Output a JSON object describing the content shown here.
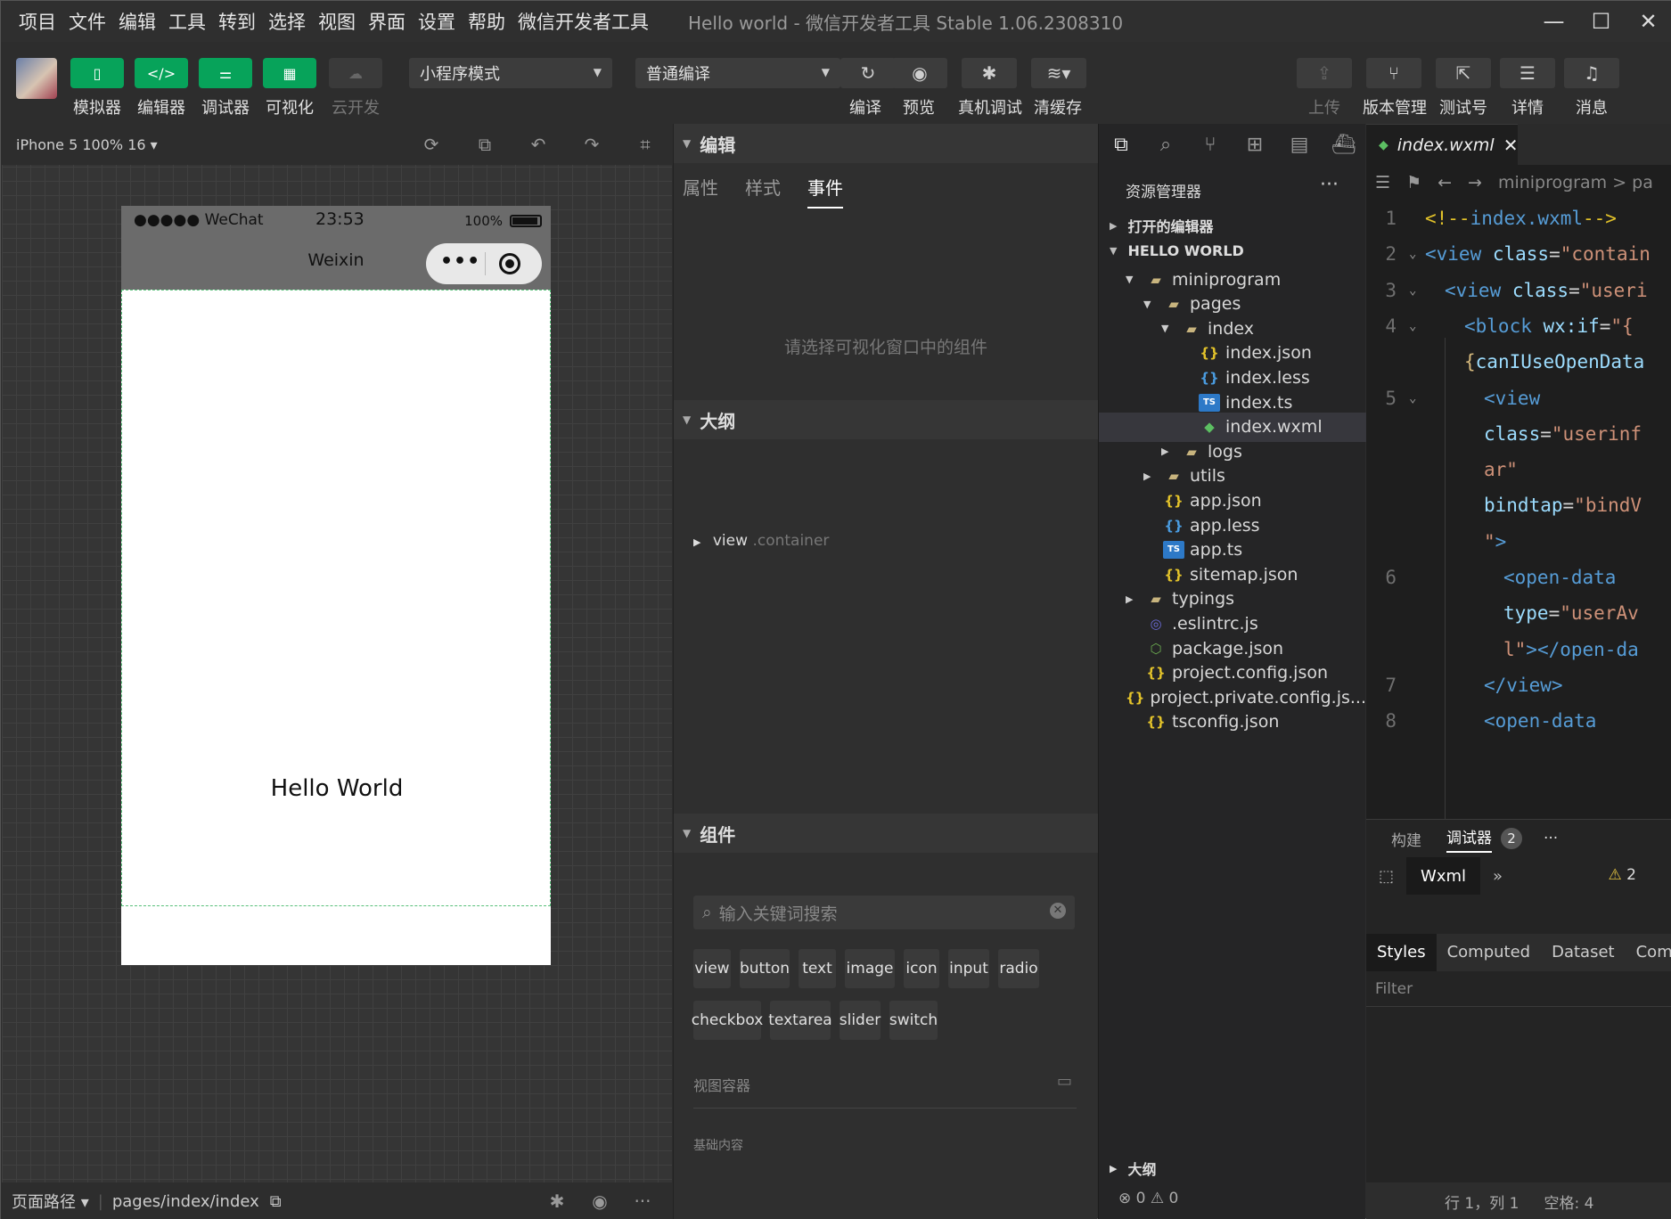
{
  "menu": [
    "项目",
    "文件",
    "编辑",
    "工具",
    "转到",
    "选择",
    "视图",
    "界面",
    "设置",
    "帮助",
    "微信开发者工具"
  ],
  "window_title": "Hello world - 微信开发者工具 Stable 1.06.2308310",
  "toolbar": {
    "simulator": "模拟器",
    "editor": "编辑器",
    "debugger": "调试器",
    "visual": "可视化",
    "cloud": "云开发",
    "mode_select": "小程序模式",
    "compile_select": "普通编译",
    "compile": "编译",
    "preview": "预览",
    "real_debug": "真机调试",
    "clear_cache": "清缓存",
    "upload": "上传",
    "version_mgmt": "版本管理",
    "test_account": "测试号",
    "details": "详情",
    "messages": "消息"
  },
  "simulator": {
    "device": "iPhone 5 100% 16",
    "status_left": "●●●●● WeChat",
    "time": "23:53",
    "battery": "100%",
    "nav_title": "Weixin",
    "content": "Hello World",
    "footer_label": "页面路径",
    "footer_path": "pages/index/index"
  },
  "edit_panel": {
    "title": "编辑",
    "tabs": [
      "属性",
      "样式",
      "事件"
    ],
    "active_tab": "事件",
    "hint": "请选择可视化窗口中的组件",
    "outline_title": "大纲",
    "outline_item": "view",
    "outline_class": ".container",
    "components_title": "组件",
    "search_placeholder": "输入关键词搜索",
    "chips_row1": [
      "view",
      "button",
      "text",
      "image",
      "icon",
      "input",
      "radio"
    ],
    "chips_row2": [
      "checkbox",
      "textarea",
      "slider",
      "switch"
    ],
    "group1": "视图容器",
    "group2": "基础内容"
  },
  "explorer": {
    "title": "资源管理器",
    "open_editors": "打开的编辑器",
    "project": "HELLO WORLD",
    "tree": [
      {
        "name": "miniprogram",
        "depth": 1,
        "type": "folder",
        "open": true
      },
      {
        "name": "pages",
        "depth": 2,
        "type": "folder",
        "open": true
      },
      {
        "name": "index",
        "depth": 3,
        "type": "folder",
        "open": true
      },
      {
        "name": "index.json",
        "depth": 4,
        "type": "json"
      },
      {
        "name": "index.less",
        "depth": 4,
        "type": "less"
      },
      {
        "name": "index.ts",
        "depth": 4,
        "type": "ts"
      },
      {
        "name": "index.wxml",
        "depth": 4,
        "type": "wxml",
        "selected": true
      },
      {
        "name": "logs",
        "depth": 3,
        "type": "folder",
        "open": false
      },
      {
        "name": "utils",
        "depth": 2,
        "type": "folder",
        "open": false
      },
      {
        "name": "app.json",
        "depth": 2,
        "type": "json"
      },
      {
        "name": "app.less",
        "depth": 2,
        "type": "less"
      },
      {
        "name": "app.ts",
        "depth": 2,
        "type": "ts"
      },
      {
        "name": "sitemap.json",
        "depth": 2,
        "type": "json"
      },
      {
        "name": "typings",
        "depth": 1,
        "type": "folder",
        "open": false
      },
      {
        "name": ".eslintrc.js",
        "depth": 1,
        "type": "eslint"
      },
      {
        "name": "package.json",
        "depth": 1,
        "type": "node"
      },
      {
        "name": "project.config.json",
        "depth": 1,
        "type": "json"
      },
      {
        "name": "project.private.config.js...",
        "depth": 1,
        "type": "json"
      },
      {
        "name": "tsconfig.json",
        "depth": 1,
        "type": "json"
      }
    ],
    "outline": "大纲",
    "status": "⊗ 0 ⚠ 0"
  },
  "editor": {
    "tab": "index.wxml",
    "breadcrumb": "miniprogram > pa",
    "lines": [
      {
        "n": "1",
        "fold": false,
        "indent": 0,
        "parts": [
          [
            "com",
            "<!--"
          ],
          [
            "tag",
            "index.wxml"
          ],
          [
            "com",
            "-->"
          ]
        ]
      },
      {
        "n": "2",
        "fold": true,
        "indent": 0,
        "parts": [
          [
            "tag",
            "<view "
          ],
          [
            "attr",
            "class"
          ],
          [
            "pl",
            "="
          ],
          [
            "str",
            "\"contain"
          ]
        ]
      },
      {
        "n": "3",
        "fold": true,
        "indent": 1,
        "parts": [
          [
            "tag",
            "<view "
          ],
          [
            "attr",
            "class"
          ],
          [
            "pl",
            "="
          ],
          [
            "str",
            "\"useri"
          ]
        ]
      },
      {
        "n": "4",
        "fold": true,
        "indent": 2,
        "parts": [
          [
            "tag",
            "<block "
          ],
          [
            "attr",
            "wx:if"
          ],
          [
            "pl",
            "="
          ],
          [
            "str",
            "\"{"
          ]
        ]
      },
      {
        "n": "",
        "fold": false,
        "indent": 2,
        "parts": [
          [
            "br",
            "{"
          ],
          [
            "attr",
            "canIUseOpenData"
          ]
        ]
      },
      {
        "n": "5",
        "fold": true,
        "indent": 3,
        "parts": [
          [
            "tag",
            "<view"
          ]
        ]
      },
      {
        "n": "",
        "fold": false,
        "indent": 3,
        "parts": [
          [
            "attr",
            "class"
          ],
          [
            "pl",
            "="
          ],
          [
            "str",
            "\"userinf"
          ]
        ]
      },
      {
        "n": "",
        "fold": false,
        "indent": 3,
        "parts": [
          [
            "str",
            "ar\""
          ]
        ]
      },
      {
        "n": "",
        "fold": false,
        "indent": 3,
        "parts": [
          [
            "attr",
            "bindtap"
          ],
          [
            "pl",
            "="
          ],
          [
            "str",
            "\"bindV"
          ]
        ]
      },
      {
        "n": "",
        "fold": false,
        "indent": 3,
        "parts": [
          [
            "str",
            "\""
          ],
          [
            "tag",
            ">"
          ]
        ]
      },
      {
        "n": "6",
        "fold": false,
        "indent": 4,
        "parts": [
          [
            "tag",
            "<open-data"
          ]
        ]
      },
      {
        "n": "",
        "fold": false,
        "indent": 4,
        "parts": [
          [
            "attr",
            "type"
          ],
          [
            "pl",
            "="
          ],
          [
            "str",
            "\"userAv"
          ]
        ]
      },
      {
        "n": "",
        "fold": false,
        "indent": 4,
        "parts": [
          [
            "str",
            "l\""
          ],
          [
            "tag",
            "></open-da"
          ]
        ]
      },
      {
        "n": "7",
        "fold": false,
        "indent": 3,
        "parts": [
          [
            "tag",
            "</view>"
          ]
        ]
      },
      {
        "n": "8",
        "fold": false,
        "indent": 3,
        "parts": [
          [
            "tag",
            "<open-data"
          ]
        ]
      }
    ]
  },
  "debugger": {
    "tab_build": "构建",
    "tab_debugger": "调试器",
    "badge": "2",
    "more": "···",
    "wxml_tab": "Wxml",
    "warnings": "2",
    "styles_tabs": [
      "Styles",
      "Computed",
      "Dataset",
      "Comp"
    ],
    "filter": "Filter"
  },
  "status_bar": {
    "position": "行 1，列 1",
    "spaces": "空格: 4"
  }
}
